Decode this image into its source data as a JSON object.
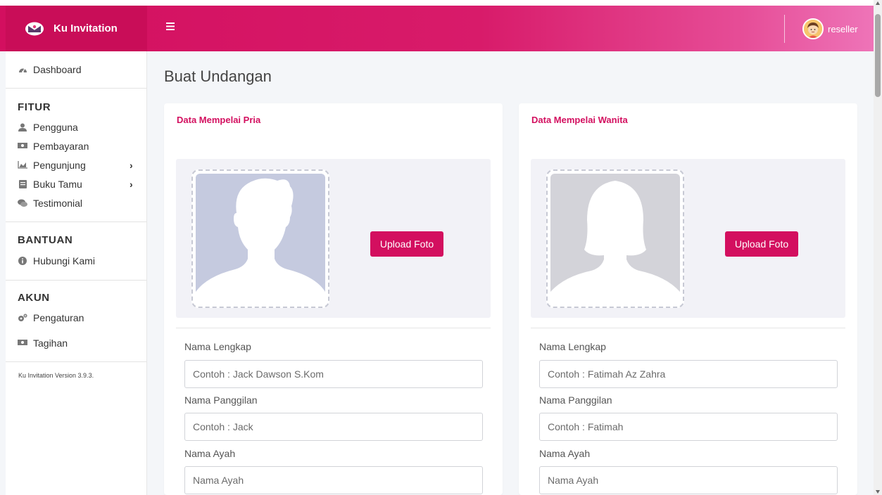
{
  "app": {
    "title": "Ku Invitation"
  },
  "user": {
    "name": "reseller"
  },
  "sidebar": {
    "dashboard": "Dashboard",
    "sections": [
      {
        "header": "FITUR",
        "items": [
          {
            "label": "Pengguna",
            "icon": "user-icon"
          },
          {
            "label": "Pembayaran",
            "icon": "money-icon"
          },
          {
            "label": "Pengunjung",
            "icon": "chart-area-icon",
            "has_submenu": true
          },
          {
            "label": "Buku Tamu",
            "icon": "book-icon",
            "has_submenu": true
          },
          {
            "label": "Testimonial",
            "icon": "comments-icon"
          }
        ]
      },
      {
        "header": "BANTUAN",
        "items": [
          {
            "label": "Hubungi Kami",
            "icon": "info-circle-icon"
          }
        ]
      },
      {
        "header": "AKUN",
        "items": [
          {
            "label": "Pengaturan",
            "icon": "cogs-icon"
          },
          {
            "label": "Tagihan",
            "icon": "money-bill-icon"
          }
        ]
      }
    ],
    "version": "Ku Invitation Version 3.9.3."
  },
  "page": {
    "title": "Buat Undangan"
  },
  "groom": {
    "title": "Data Mempelai Pria",
    "upload_label": "Upload Foto",
    "fields": {
      "full_name": {
        "label": "Nama Lengkap",
        "placeholder": "Contoh : Jack Dawson S.Kom"
      },
      "nickname": {
        "label": "Nama Panggilan",
        "placeholder": "Contoh : Jack"
      },
      "father": {
        "label": "Nama Ayah",
        "placeholder": "Nama Ayah"
      }
    }
  },
  "bride": {
    "title": "Data Mempelai Wanita",
    "upload_label": "Upload Foto",
    "fields": {
      "full_name": {
        "label": "Nama Lengkap",
        "placeholder": "Contoh : Fatimah Az Zahra"
      },
      "nickname": {
        "label": "Nama Panggilan",
        "placeholder": "Contoh : Fatimah"
      },
      "father": {
        "label": "Nama Ayah",
        "placeholder": "Nama Ayah"
      }
    }
  },
  "colors": {
    "accent": "#d30f5f",
    "accent_light": "#ee74b8",
    "male_placeholder": "#c5cadf",
    "female_placeholder": "#d3d3d9"
  }
}
